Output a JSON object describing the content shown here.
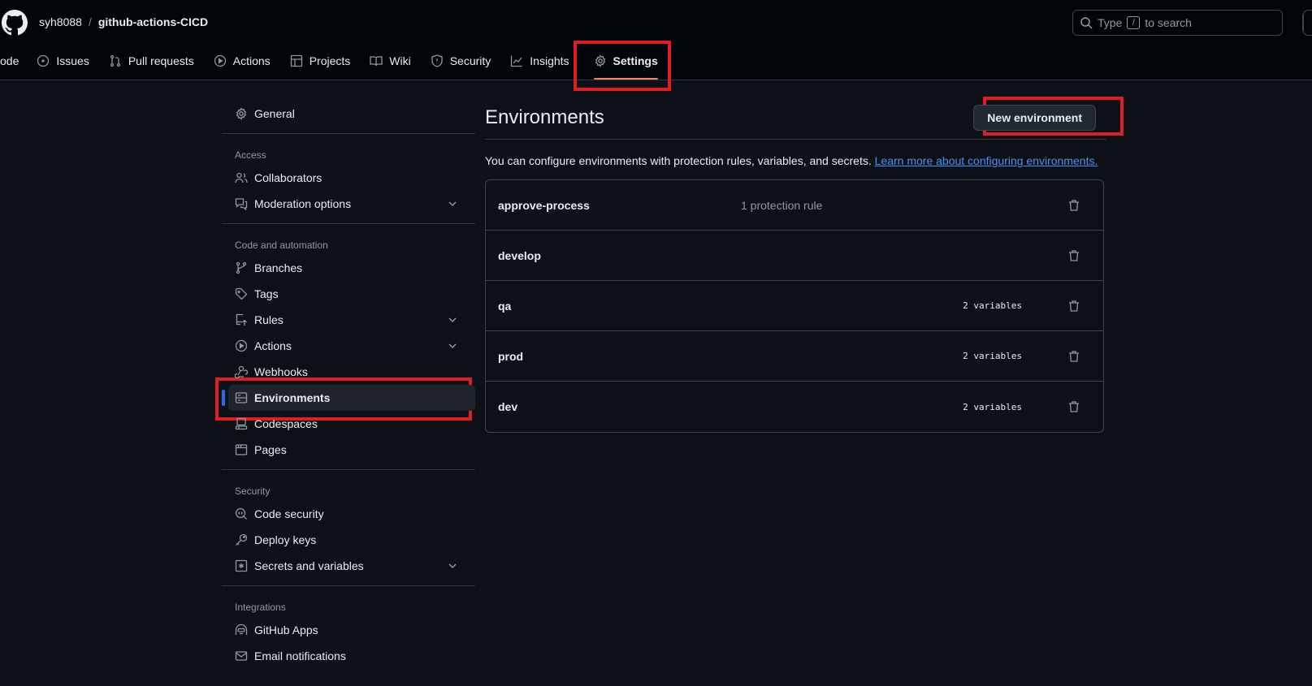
{
  "header": {
    "owner": "syh8088",
    "separator": "/",
    "repo": "github-actions-CICD",
    "search_placeholder_before": "Type",
    "search_key": "/",
    "search_placeholder_after": "to search"
  },
  "repo_nav": [
    {
      "label": "Code",
      "icon": "code-icon",
      "visible_label": "ode"
    },
    {
      "label": "Issues",
      "icon": "issue-opened-icon"
    },
    {
      "label": "Pull requests",
      "icon": "git-pull-request-icon"
    },
    {
      "label": "Actions",
      "icon": "play-icon"
    },
    {
      "label": "Projects",
      "icon": "table-icon"
    },
    {
      "label": "Wiki",
      "icon": "book-icon"
    },
    {
      "label": "Security",
      "icon": "shield-icon"
    },
    {
      "label": "Insights",
      "icon": "graph-icon"
    },
    {
      "label": "Settings",
      "icon": "gear-icon",
      "active": true
    }
  ],
  "sidebar": {
    "general": "General",
    "sections": [
      {
        "heading": "Access",
        "items": [
          {
            "label": "Collaborators",
            "icon": "people-icon"
          },
          {
            "label": "Moderation options",
            "icon": "comment-discussion-icon",
            "expandable": true
          }
        ]
      },
      {
        "heading": "Code and automation",
        "items": [
          {
            "label": "Branches",
            "icon": "git-branch-icon"
          },
          {
            "label": "Tags",
            "icon": "tag-icon"
          },
          {
            "label": "Rules",
            "icon": "repo-push-icon",
            "expandable": true
          },
          {
            "label": "Actions",
            "icon": "play-icon",
            "expandable": true
          },
          {
            "label": "Webhooks",
            "icon": "webhook-icon"
          },
          {
            "label": "Environments",
            "icon": "server-icon",
            "selected": true
          },
          {
            "label": "Codespaces",
            "icon": "codespaces-icon"
          },
          {
            "label": "Pages",
            "icon": "browser-icon"
          }
        ]
      },
      {
        "heading": "Security",
        "items": [
          {
            "label": "Code security",
            "icon": "codescan-icon"
          },
          {
            "label": "Deploy keys",
            "icon": "key-icon"
          },
          {
            "label": "Secrets and variables",
            "icon": "key-asterisk-icon",
            "expandable": true
          }
        ]
      },
      {
        "heading": "Integrations",
        "items": [
          {
            "label": "GitHub Apps",
            "icon": "hubot-icon"
          },
          {
            "label": "Email notifications",
            "icon": "mail-icon"
          }
        ]
      }
    ]
  },
  "main": {
    "title": "Environments",
    "new_button": "New environment",
    "description": "You can configure environments with protection rules, variables, and secrets.",
    "learn_more": "Learn more about configuring environments.",
    "environments": [
      {
        "name": "approve-process",
        "rules": "1 protection rule",
        "vars": ""
      },
      {
        "name": "develop",
        "rules": "",
        "vars": ""
      },
      {
        "name": "qa",
        "rules": "",
        "vars": "2 variables"
      },
      {
        "name": "prod",
        "rules": "",
        "vars": "2 variables"
      },
      {
        "name": "dev",
        "rules": "",
        "vars": "2 variables"
      }
    ]
  },
  "colors": {
    "accent_blue": "#1f6feb",
    "link": "#4493f8",
    "tab_underline": "#f78166",
    "annotation_red": "#e11d24"
  }
}
